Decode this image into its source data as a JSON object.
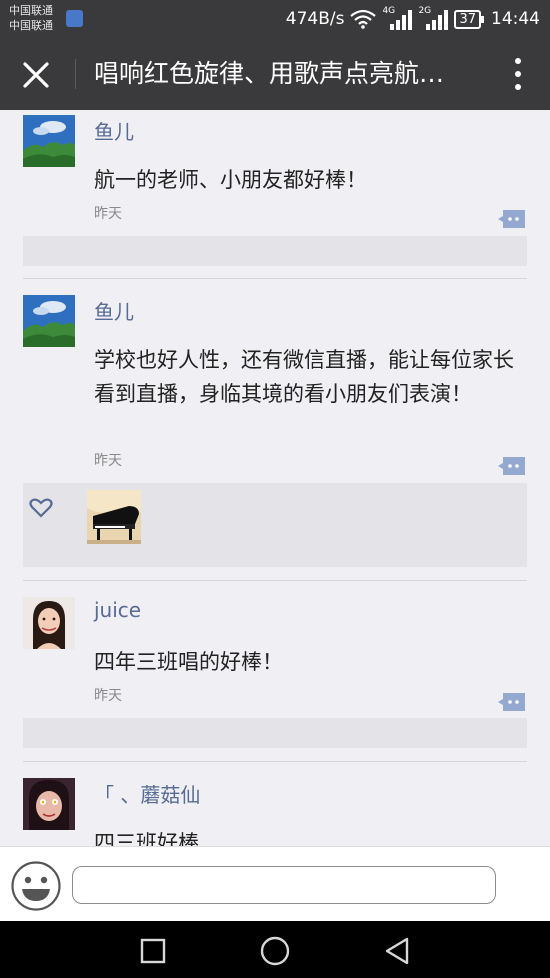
{
  "status_bar": {
    "carrier_1": "中国联通",
    "carrier_2": "中国联通",
    "speed": "474B/s",
    "network_1": "4G",
    "network_2": "2G",
    "battery": "37",
    "time": "14:44"
  },
  "header": {
    "title": "唱响红色旋律、用歌声点亮航…"
  },
  "comments": [
    {
      "author": "鱼儿",
      "text": "航一的老师、小朋友都好棒！",
      "time": "昨天"
    },
    {
      "author": "鱼儿",
      "text": "学校也好人性，还有微信直播，能让每位家长看到直播，身临其境的看小朋友们表演！",
      "time": "昨天"
    },
    {
      "author": "juice",
      "text": "四年三班唱的好棒！",
      "time": "昨天"
    },
    {
      "author": "「 、蘑菇仙",
      "text": "四三班好棒",
      "time": ""
    }
  ],
  "input": {
    "value": "",
    "placeholder": ""
  },
  "icons": {
    "close": "close-icon",
    "more": "more-vertical-icon",
    "reply": "comment-bubble-icon",
    "like": "heart-icon",
    "emoji": "emoji-icon",
    "nav_recent": "square-icon",
    "nav_home": "circle-icon",
    "nav_back": "triangle-back-icon"
  },
  "colors": {
    "topbar": "#3a3a3c",
    "username": "#576b95",
    "reply_icon": "#93a9cf"
  }
}
